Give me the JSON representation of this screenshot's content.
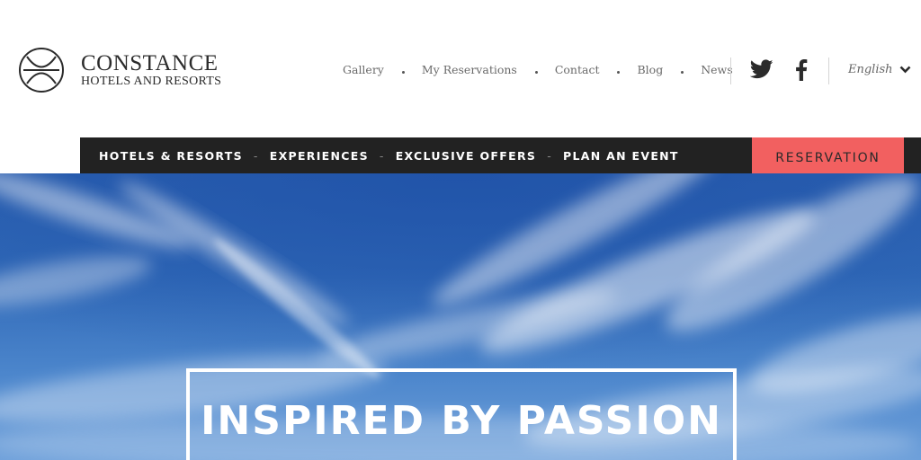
{
  "brand": {
    "name": "CONSTANCE",
    "subtitle": "HOTELS AND RESORTS"
  },
  "top_nav": {
    "items": [
      {
        "label": "Gallery"
      },
      {
        "label": "My Reservations"
      },
      {
        "label": "Contact"
      },
      {
        "label": "Blog"
      },
      {
        "label": "News"
      }
    ]
  },
  "social": {
    "icons": [
      "twitter-icon",
      "facebook-icon"
    ]
  },
  "language": {
    "selected": "English"
  },
  "main_nav": {
    "items": [
      {
        "label": "HOTELS & RESORTS"
      },
      {
        "label": "EXPERIENCES"
      },
      {
        "label": "EXCLUSIVE OFFERS"
      },
      {
        "label": "PLAN AN EVENT"
      }
    ],
    "separator": "-"
  },
  "reservation": {
    "label": "RESERVATION"
  },
  "hero": {
    "title": "INSPIRED BY PASSION"
  },
  "colors": {
    "nav_bg": "#222222",
    "reservation_bg": "#f26060",
    "text_gray": "#6a6a6a",
    "sky_blue": "#2f68b7"
  }
}
